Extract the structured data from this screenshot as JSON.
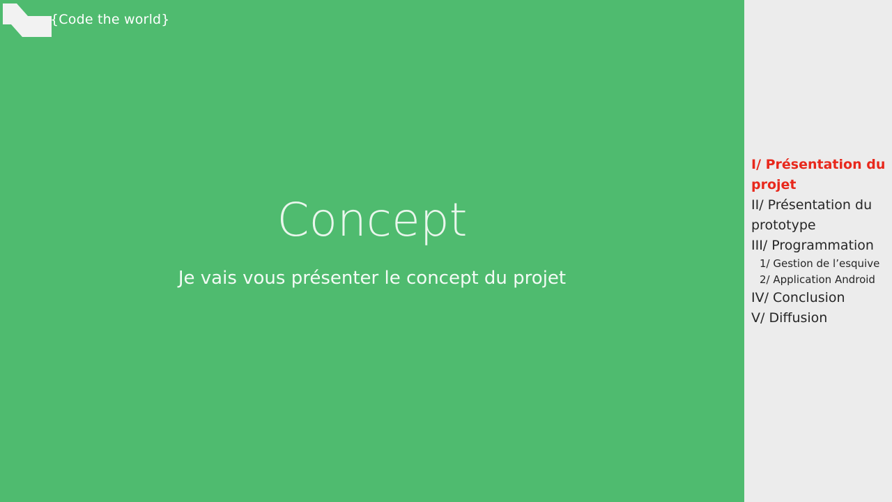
{
  "logo": {
    "text": "{Code the world}"
  },
  "slide": {
    "title": "Concept",
    "subtitle": "Je vais vous présenter le concept du projet"
  },
  "toc": {
    "items": [
      {
        "label": "I/ Présentation du projet"
      },
      {
        "label": "II/ Présentation du prototype"
      },
      {
        "label": "III/ Programmation"
      },
      {
        "label": "1/ Gestion de l’esquive"
      },
      {
        "label": "2/ Application Android"
      },
      {
        "label": "IV/ Conclusion"
      },
      {
        "label": "V/ Diffusion"
      }
    ]
  },
  "colors": {
    "main_background": "#4fbb6f",
    "sidebar_background": "#ececec",
    "active_item": "#e8281c",
    "text_dark": "#262626"
  }
}
